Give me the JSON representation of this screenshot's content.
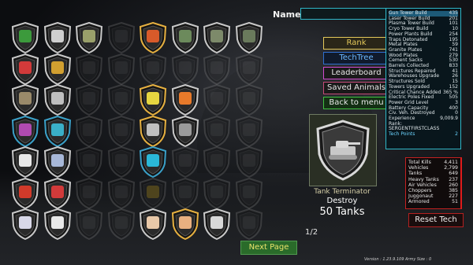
{
  "name_label": "Name:",
  "menu": [
    {
      "label": "Rank",
      "color": "#e4c95a",
      "border": "#e4c95a",
      "bg": "#2a2618"
    },
    {
      "label": "TechTree",
      "color": "#6cb8ff",
      "border": "#2f6fd1",
      "bg": "#101a2c"
    },
    {
      "label": "Leaderboard",
      "color": "#e8e8e8",
      "border": "#d24bd0",
      "bg": "#1a1a1a"
    },
    {
      "label": "Saved Animals",
      "color": "#e8e8e8",
      "border": "#c64b78",
      "bg": "#1a1a1a"
    },
    {
      "label": "Back to menu",
      "color": "#e8e8e8",
      "border": "#41c241",
      "bg": "#143014"
    }
  ],
  "stats": [
    {
      "label": "Gun Tower Build",
      "value": "435",
      "hl": true
    },
    {
      "label": "Laser Tower Build",
      "value": "201"
    },
    {
      "label": "Plasma Tower Build",
      "value": "101"
    },
    {
      "label": "Cryo Tower Build",
      "value": "10"
    },
    {
      "label": "Power Plants Build",
      "value": "254"
    },
    {
      "label": "Traps Detonated",
      "value": "195"
    },
    {
      "label": "Metal Plates",
      "value": "59"
    },
    {
      "label": "Granite Plates",
      "value": "741"
    },
    {
      "label": "Wood Plates",
      "value": "279"
    },
    {
      "label": "Cement Sacks",
      "value": "530"
    },
    {
      "label": "Barrels Collected",
      "value": "833"
    },
    {
      "label": "Structures Repaired",
      "value": "41"
    },
    {
      "label": "Warehouses Upgrade",
      "value": "26"
    },
    {
      "label": "Structures Sold",
      "value": "15"
    },
    {
      "label": "Towers Upgraded",
      "value": "152"
    },
    {
      "label": "Critical Chance Added",
      "value": "365 %"
    },
    {
      "label": "Electric Poles Fixed",
      "value": "505"
    },
    {
      "label": "Power Grid Level",
      "value": "3"
    },
    {
      "label": "Battery Capacity",
      "value": "400"
    },
    {
      "label": "Civ. Veh. Destroyed",
      "value": "0"
    },
    {
      "label": "Experience",
      "value": "9,009.9"
    },
    {
      "label": "Rank:",
      "value": ""
    },
    {
      "label": "SERGENTFIRSTCLASS",
      "value": ""
    }
  ],
  "tech_points": {
    "label": "Tech Points",
    "value": "2"
  },
  "kills": [
    {
      "label": "Total Kills",
      "value": "4,411"
    },
    {
      "label": "Vehicles",
      "value": "2,799"
    },
    {
      "label": "Tanks",
      "value": "649"
    },
    {
      "label": "Heavy Tanks",
      "value": "237"
    },
    {
      "label": "Air Vehicles",
      "value": "260"
    },
    {
      "label": "Choppers",
      "value": "385"
    },
    {
      "label": "Juggonaut",
      "value": "227"
    },
    {
      "label": "Armored",
      "value": "51"
    }
  ],
  "reset_label": "Reset Tech",
  "achievement": {
    "title": "Tank Terminator",
    "line2": "Destroy",
    "line3": "50 Tanks"
  },
  "page": "1/2",
  "next_label": "Next Page",
  "version": "Version : 1.23.9.109  Army Size : 0",
  "badges": [
    {
      "row": 0,
      "col": 0,
      "icon": "truck-icon",
      "ring": "#c8c8c8",
      "fill": "#3c9a3c",
      "dim": false
    },
    {
      "row": 0,
      "col": 1,
      "icon": "armored-car-icon",
      "ring": "#c8c8c8",
      "fill": "#cfcfcf",
      "dim": false
    },
    {
      "row": 0,
      "col": 2,
      "icon": "military-truck-icon",
      "ring": "#c8c8c8",
      "fill": "#9aa06a",
      "dim": false
    },
    {
      "row": 0,
      "col": 3,
      "icon": "locked-icon",
      "ring": "#888",
      "fill": "#555",
      "dim": true
    },
    {
      "row": 0,
      "col": 4,
      "icon": "rocket-icon",
      "ring": "#e6b040",
      "fill": "#d85a2a",
      "dim": false
    },
    {
      "row": 0,
      "col": 5,
      "icon": "tank-icon",
      "ring": "#c8c8c8",
      "fill": "#6c8a5c",
      "dim": false
    },
    {
      "row": 0,
      "col": 6,
      "icon": "tank-icon",
      "ring": "#c8c8c8",
      "fill": "#7d8a6a",
      "dim": false
    },
    {
      "row": 0,
      "col": 7,
      "icon": "tank-icon",
      "ring": "#c8c8c8",
      "fill": "#6a7a5c",
      "dim": false
    },
    {
      "row": 1,
      "col": 0,
      "icon": "helicopter-icon",
      "ring": "#c8c8c8",
      "fill": "#d23a3a",
      "dim": false
    },
    {
      "row": 1,
      "col": 1,
      "icon": "helicopter-icon",
      "ring": "#c8c8c8",
      "fill": "#d2a030",
      "dim": false
    },
    {
      "row": 1,
      "col": 2,
      "icon": "locked-icon",
      "ring": "#888",
      "fill": "#555",
      "dim": true
    },
    {
      "row": 1,
      "col": 3,
      "icon": "locked-icon",
      "ring": "#888",
      "fill": "#555",
      "dim": true
    },
    {
      "row": 1,
      "col": 4,
      "icon": "locked-icon",
      "ring": "#888",
      "fill": "#555",
      "dim": true
    },
    {
      "row": 1,
      "col": 5,
      "icon": "locked-icon",
      "ring": "#888",
      "fill": "#555",
      "dim": true
    },
    {
      "row": 1,
      "col": 6,
      "icon": "locked-icon",
      "ring": "#888",
      "fill": "#555",
      "dim": true
    },
    {
      "row": 1,
      "col": 7,
      "icon": "locked-icon",
      "ring": "#888",
      "fill": "#555",
      "dim": true
    },
    {
      "row": 2,
      "col": 0,
      "icon": "watchtower-icon",
      "ring": "#c8c8c8",
      "fill": "#9a8a6a",
      "dim": false
    },
    {
      "row": 2,
      "col": 1,
      "icon": "cage-icon",
      "ring": "#c8c8c8",
      "fill": "#bfbfbf",
      "dim": false
    },
    {
      "row": 2,
      "col": 2,
      "icon": "locked-icon",
      "ring": "#888",
      "fill": "#555",
      "dim": true
    },
    {
      "row": 2,
      "col": 3,
      "icon": "locked-icon",
      "ring": "#888",
      "fill": "#555",
      "dim": true
    },
    {
      "row": 2,
      "col": 4,
      "icon": "laser-icon",
      "ring": "#e6b040",
      "fill": "#e6d640",
      "dim": false
    },
    {
      "row": 2,
      "col": 5,
      "icon": "torch-icon",
      "ring": "#c8c8c8",
      "fill": "#e87a2a",
      "dim": false
    },
    {
      "row": 2,
      "col": 6,
      "icon": "locked-icon",
      "ring": "#888",
      "fill": "#555",
      "dim": true
    },
    {
      "row": 2,
      "col": 7,
      "icon": "locked-icon",
      "ring": "#888",
      "fill": "#555",
      "dim": true
    },
    {
      "row": 3,
      "col": 0,
      "icon": "virus-icon",
      "ring": "#3aa0c8",
      "fill": "#b04ab0",
      "dim": false
    },
    {
      "row": 3,
      "col": 1,
      "icon": "virus-icon",
      "ring": "#3aa0c8",
      "fill": "#3ab0c8",
      "dim": false
    },
    {
      "row": 3,
      "col": 2,
      "icon": "locked-icon",
      "ring": "#888",
      "fill": "#555",
      "dim": true
    },
    {
      "row": 3,
      "col": 3,
      "icon": "locked-icon",
      "ring": "#888",
      "fill": "#555",
      "dim": true
    },
    {
      "row": 3,
      "col": 4,
      "icon": "boot-icon",
      "ring": "#e6b040",
      "fill": "#bfbfbf",
      "dim": false
    },
    {
      "row": 3,
      "col": 5,
      "icon": "boot-icon",
      "ring": "#c8c8c8",
      "fill": "#9a9a9a",
      "dim": false
    },
    {
      "row": 3,
      "col": 6,
      "icon": "locked-icon",
      "ring": "#888",
      "fill": "#555",
      "dim": true
    },
    {
      "row": 3,
      "col": 7,
      "icon": "locked-icon",
      "ring": "#888",
      "fill": "#555",
      "dim": true
    },
    {
      "row": 4,
      "col": 0,
      "icon": "paper-plane-icon",
      "ring": "#c8c8c8",
      "fill": "#e8e8e8",
      "dim": false
    },
    {
      "row": 4,
      "col": 1,
      "icon": "jet-icon",
      "ring": "#c8c8c8",
      "fill": "#a8b8d8",
      "dim": false
    },
    {
      "row": 4,
      "col": 2,
      "icon": "locked-icon",
      "ring": "#888",
      "fill": "#555",
      "dim": true
    },
    {
      "row": 4,
      "col": 3,
      "icon": "locked-icon",
      "ring": "#888",
      "fill": "#555",
      "dim": true
    },
    {
      "row": 4,
      "col": 4,
      "icon": "penguin-icon",
      "ring": "#3aa0c8",
      "fill": "#2ab8d8",
      "dim": false
    },
    {
      "row": 4,
      "col": 5,
      "icon": "locked-icon",
      "ring": "#888",
      "fill": "#555",
      "dim": true
    },
    {
      "row": 4,
      "col": 6,
      "icon": "locked-icon",
      "ring": "#888",
      "fill": "#555",
      "dim": true
    },
    {
      "row": 4,
      "col": 7,
      "icon": "locked-icon",
      "ring": "#888",
      "fill": "#555",
      "dim": true
    },
    {
      "row": 5,
      "col": 0,
      "icon": "flag-icon",
      "ring": "#c8c8c8",
      "fill": "#d23a2a",
      "dim": false
    },
    {
      "row": 5,
      "col": 1,
      "icon": "shield-flag-icon",
      "ring": "#c8c8c8",
      "fill": "#d23a3a",
      "dim": false
    },
    {
      "row": 5,
      "col": 2,
      "icon": "locked-icon",
      "ring": "#888",
      "fill": "#555",
      "dim": true
    },
    {
      "row": 5,
      "col": 3,
      "icon": "locked-icon",
      "ring": "#888",
      "fill": "#555",
      "dim": true
    },
    {
      "row": 5,
      "col": 4,
      "icon": "road-sign-icon",
      "ring": "#888",
      "fill": "#d8b020",
      "dim": true
    },
    {
      "row": 5,
      "col": 5,
      "icon": "locked-icon",
      "ring": "#888",
      "fill": "#555",
      "dim": true
    },
    {
      "row": 5,
      "col": 6,
      "icon": "locked-icon",
      "ring": "#888",
      "fill": "#555",
      "dim": true
    },
    {
      "row": 5,
      "col": 7,
      "icon": "locked-icon",
      "ring": "#888",
      "fill": "#555",
      "dim": true
    },
    {
      "row": 6,
      "col": 0,
      "icon": "plate-icon",
      "ring": "#c8c8c8",
      "fill": "#d8d8e8",
      "dim": false
    },
    {
      "row": 6,
      "col": 1,
      "icon": "plate-icon",
      "ring": "#c8c8c8",
      "fill": "#e8e8e8",
      "dim": false
    },
    {
      "row": 6,
      "col": 2,
      "icon": "locked-icon",
      "ring": "#888",
      "fill": "#555",
      "dim": true
    },
    {
      "row": 6,
      "col": 3,
      "icon": "locked-icon",
      "ring": "#888",
      "fill": "#555",
      "dim": true
    },
    {
      "row": 6,
      "col": 4,
      "icon": "sack-icon",
      "ring": "#c8c8c8",
      "fill": "#e8c8a8",
      "dim": false
    },
    {
      "row": 6,
      "col": 5,
      "icon": "sack-icon",
      "ring": "#e6b040",
      "fill": "#e8b080",
      "dim": false
    },
    {
      "row": 6,
      "col": 6,
      "icon": "granite-icon",
      "ring": "#c8c8c8",
      "fill": "#d8d8d8",
      "dim": false
    },
    {
      "row": 6,
      "col": 7,
      "icon": "locked-icon",
      "ring": "#888",
      "fill": "#555",
      "dim": true
    }
  ]
}
